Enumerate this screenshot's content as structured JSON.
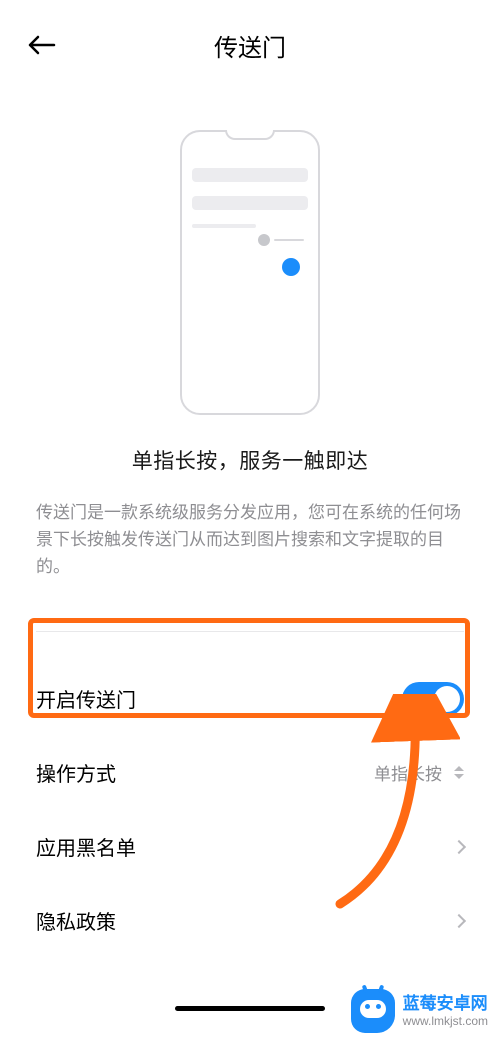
{
  "header": {
    "title": "传送门"
  },
  "illustration": {
    "caption": "单指长按，服务一触即达",
    "description": "传送门是一款系统级服务分发应用，您可在系统的任何场景下长按触发传送门从而达到图片搜索和文字提取的目的。"
  },
  "settings": {
    "enable": {
      "label": "开启传送门",
      "on": true
    },
    "operation": {
      "label": "操作方式",
      "value": "单指长按"
    },
    "blacklist": {
      "label": "应用黑名单"
    },
    "privacy": {
      "label": "隐私政策"
    }
  },
  "watermark": {
    "text_cn": "蓝莓安卓网",
    "url": "www.lmkjst.com"
  }
}
